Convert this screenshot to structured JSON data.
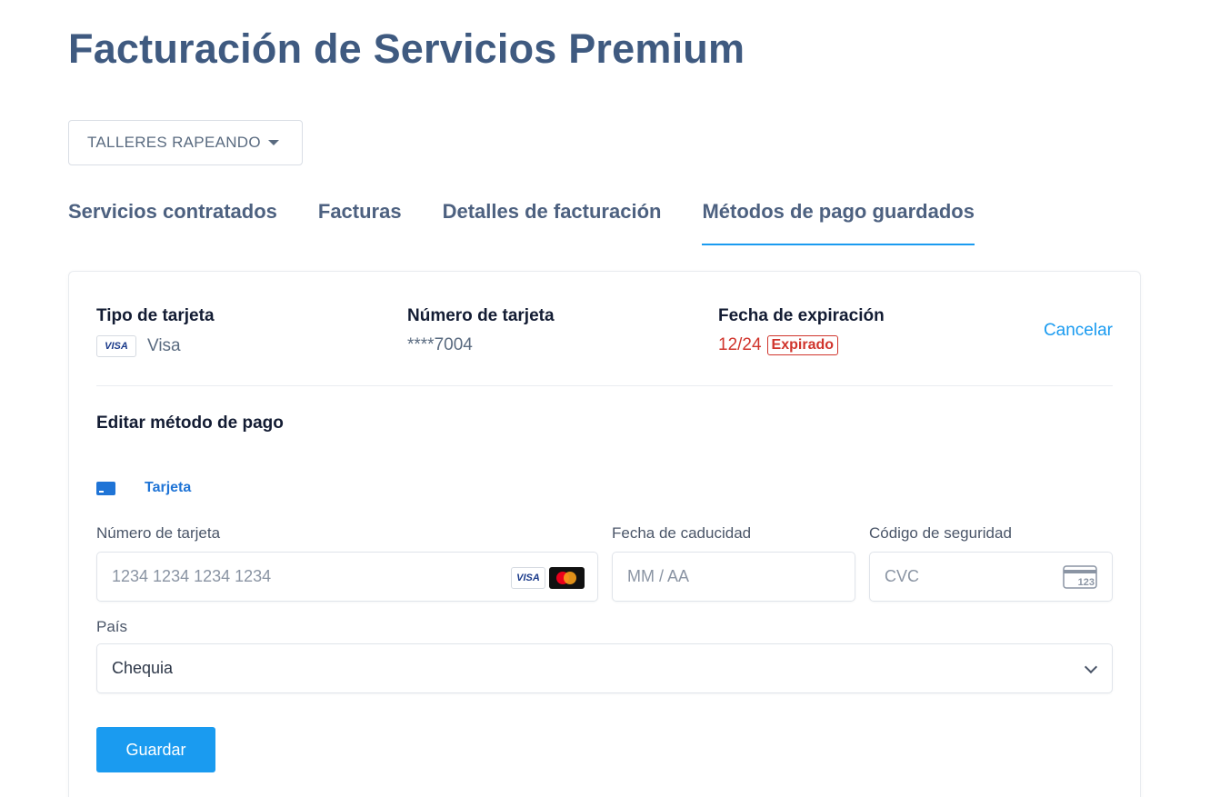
{
  "page": {
    "title": "Facturación de Servicios Premium"
  },
  "org_selector": {
    "value": "TALLERES RAPEANDO"
  },
  "tabs": [
    {
      "label": "Servicios contratados",
      "active": false
    },
    {
      "label": "Facturas",
      "active": false
    },
    {
      "label": "Detalles de facturación",
      "active": false
    },
    {
      "label": "Métodos de pago guardados",
      "active": true
    }
  ],
  "saved_card": {
    "type_label": "Tipo de tarjeta",
    "type_badge": "VISA",
    "type_value": "Visa",
    "number_label": "Número de tarjeta",
    "number_value": "****7004",
    "expiry_label": "Fecha de expiración",
    "expiry_value": "12/24",
    "expiry_status": "Expirado",
    "cancel_label": "Cancelar"
  },
  "edit_form": {
    "title": "Editar método de pago",
    "method_tab": "Tarjeta",
    "card_number": {
      "label": "Número de tarjeta",
      "placeholder": "1234 1234 1234 1234",
      "brand_visa": "VISA"
    },
    "expiry": {
      "label": "Fecha de caducidad",
      "placeholder": "MM / AA"
    },
    "cvc": {
      "label": "Código de seguridad",
      "placeholder": "CVC",
      "icon_text": "123"
    },
    "country": {
      "label": "País",
      "value": "Chequia"
    },
    "save_label": "Guardar"
  },
  "colors": {
    "accent": "#1a9bf0",
    "title": "#3f5a80",
    "error": "#d0342c",
    "method_blue": "#1f74d6"
  }
}
